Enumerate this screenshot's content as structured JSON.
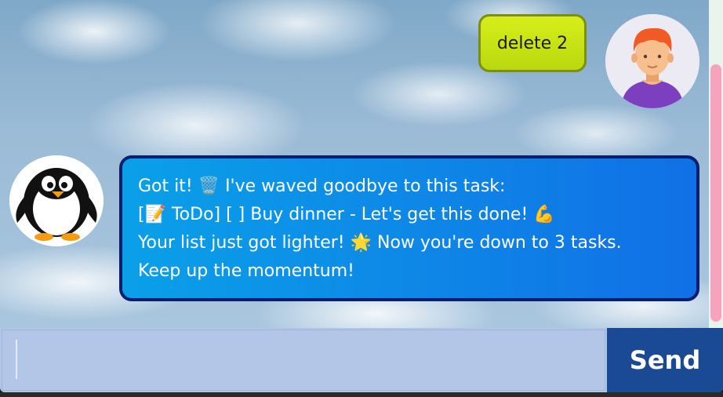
{
  "chat": {
    "user_message": "delete 2",
    "bot_message_lines": [
      "Got it! 🗑️ I've waved goodbye to this task:",
      "[📝 ToDo] [ ] Buy dinner - Let's get this done! 💪",
      "Your list just got lighter! 🌟 Now you're down to 3 tasks.",
      "Keep up the momentum!"
    ]
  },
  "input": {
    "value": "",
    "send_label": "Send"
  },
  "colors": {
    "user_bubble": "#c8e014",
    "bot_bubble_start": "#0aa0e8",
    "bot_bubble_end": "#1170e6",
    "send_button": "#1a4a93",
    "input_bar": "#b1c5e6",
    "scrollbar": "#f5a3bf"
  },
  "icons": {
    "user_avatar": "user-avatar-icon",
    "bot_avatar": "penguin-avatar-icon"
  }
}
